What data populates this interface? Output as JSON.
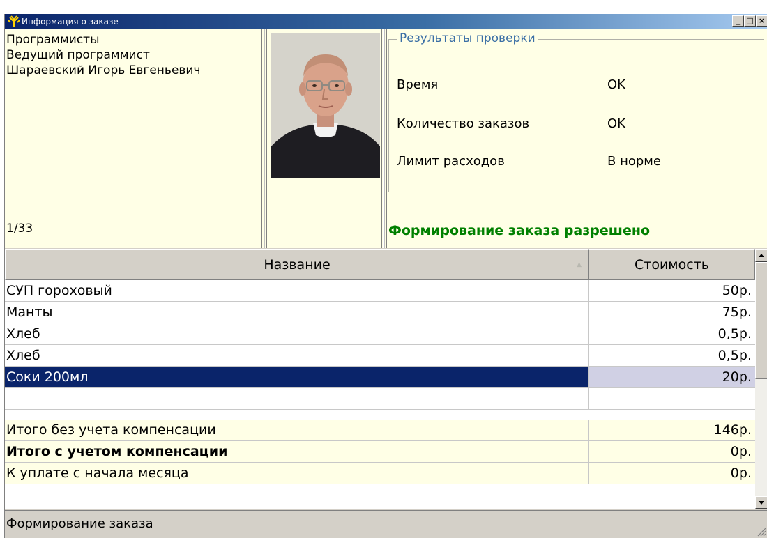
{
  "window": {
    "title": "Информация о заказе",
    "icon": "tree-app-icon",
    "controls": {
      "minimize": "_",
      "maximize": "□",
      "close": "×"
    }
  },
  "person": {
    "department": "Программисты",
    "position": "Ведущий программист",
    "name": "Шараевский Игорь Евгеньевич",
    "counter": "1/33"
  },
  "check": {
    "title": "Результаты проверки",
    "rows": [
      {
        "label": "Время",
        "value": "OK"
      },
      {
        "label": "Количество заказов",
        "value": "OK"
      },
      {
        "label": "Лимит расходов",
        "value": "В норме"
      }
    ],
    "verdict": "Формирование заказа разрешено",
    "verdict_color": "#008000"
  },
  "table": {
    "columns": {
      "name": "Название",
      "cost": "Стоимость"
    },
    "rows": [
      {
        "name": "СУП гороховый",
        "cost": "50р."
      },
      {
        "name": "Манты",
        "cost": "75р."
      },
      {
        "name": "Хлеб",
        "cost": "0,5р."
      },
      {
        "name": "Хлеб",
        "cost": "0,5р."
      },
      {
        "name": "Соки 200мл",
        "cost": "20р."
      }
    ],
    "totals": [
      {
        "name": "Итого без учета компенсации",
        "cost": "146р."
      },
      {
        "name": "Итого с учетом компенсации",
        "cost": "0р."
      },
      {
        "name": "К уплате с начала месяца",
        "cost": "0р."
      }
    ]
  },
  "status": {
    "text": "Формирование заказа"
  },
  "colors": {
    "selection": "#0a246a",
    "panel": "#ffffe6",
    "title_gradient_start": "#0a246a",
    "title_gradient_end": "#a6caf0"
  }
}
